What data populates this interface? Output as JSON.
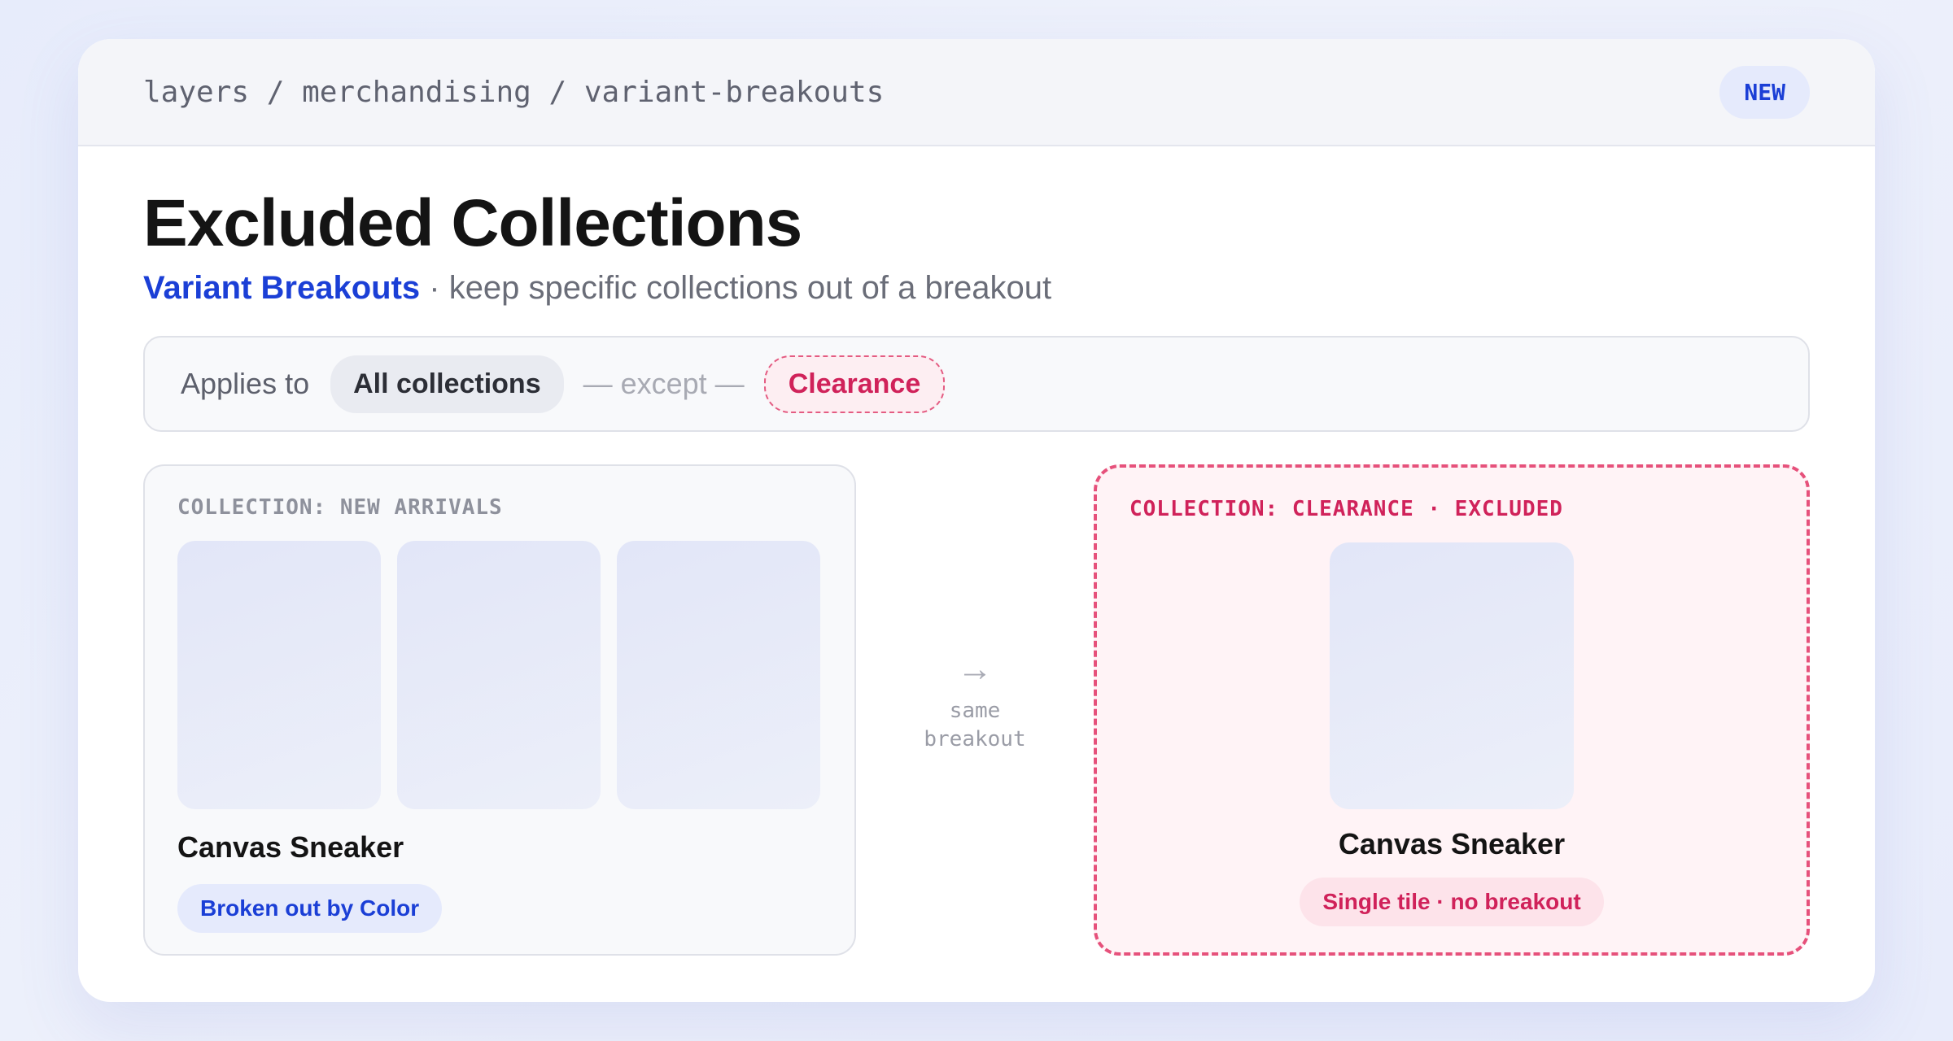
{
  "header": {
    "breadcrumb": "layers / merchandising / variant-breakouts",
    "badge": "NEW"
  },
  "page": {
    "title": "Excluded Collections",
    "subtitle_accent": "Variant Breakouts",
    "subtitle_rest": " · keep specific collections out of a breakout"
  },
  "rule": {
    "applies_label": "Applies to",
    "scope": "All collections",
    "except_label": "— except —",
    "excluded": "Clearance"
  },
  "panels": {
    "included": {
      "label": "COLLECTION: NEW ARRIVALS",
      "product": "Canvas Sneaker",
      "status": "Broken out by Color",
      "tile_count": 3
    },
    "connector": {
      "arrow": "→",
      "caption_line1": "same",
      "caption_line2": "breakout"
    },
    "excluded": {
      "label": "COLLECTION: CLEARANCE · EXCLUDED",
      "product": "Canvas Sneaker",
      "status": "Single tile · no breakout",
      "tile_count": 1
    }
  },
  "colors": {
    "accent": "#1b3fd6",
    "excluded": "#d0225a"
  }
}
